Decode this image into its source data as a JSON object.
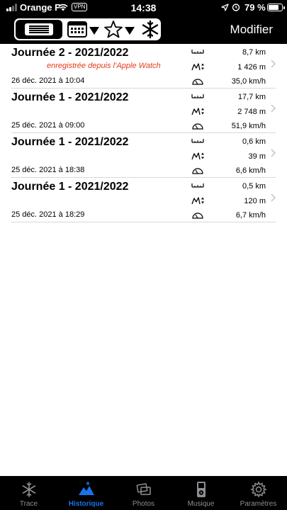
{
  "status_bar": {
    "carrier": "Orange F",
    "vpn": "VPN",
    "time": "14:38",
    "battery_pct": "79 %",
    "battery_level": 0.79
  },
  "header": {
    "edit_label": "Modifier"
  },
  "entries": [
    {
      "title": "Journée 2 - 2021/2022",
      "source": "enregistrée depuis l’Apple Watch",
      "date": "26 déc. 2021 à 10:04",
      "distance": "8,7 km",
      "elevation": "1 426 m",
      "speed": "35,0 km/h"
    },
    {
      "title": "Journée 1 - 2021/2022",
      "source": "",
      "date": "25 déc. 2021 à 09:00",
      "distance": "17,7 km",
      "elevation": "2 748 m",
      "speed": "51,9 km/h"
    },
    {
      "title": "Journée 1 - 2021/2022",
      "source": "",
      "date": "25 déc. 2021 à 18:38",
      "distance": "0,6 km",
      "elevation": "39 m",
      "speed": "6,6 km/h"
    },
    {
      "title": "Journée 1 - 2021/2022",
      "source": "",
      "date": "25 déc. 2021 à 18:29",
      "distance": "0,5 km",
      "elevation": "120 m",
      "speed": "6,7 km/h"
    }
  ],
  "tabbar": {
    "active_color": "#1a73e8",
    "inactive_color": "#8e8e93",
    "tabs": [
      {
        "label": "Trace",
        "icon": "snowflake-icon"
      },
      {
        "label": "Historique",
        "icon": "mountain-icon"
      },
      {
        "label": "Photos",
        "icon": "photos-icon"
      },
      {
        "label": "Musique",
        "icon": "ipod-icon"
      },
      {
        "label": "Paramètres",
        "icon": "gear-icon"
      }
    ]
  }
}
